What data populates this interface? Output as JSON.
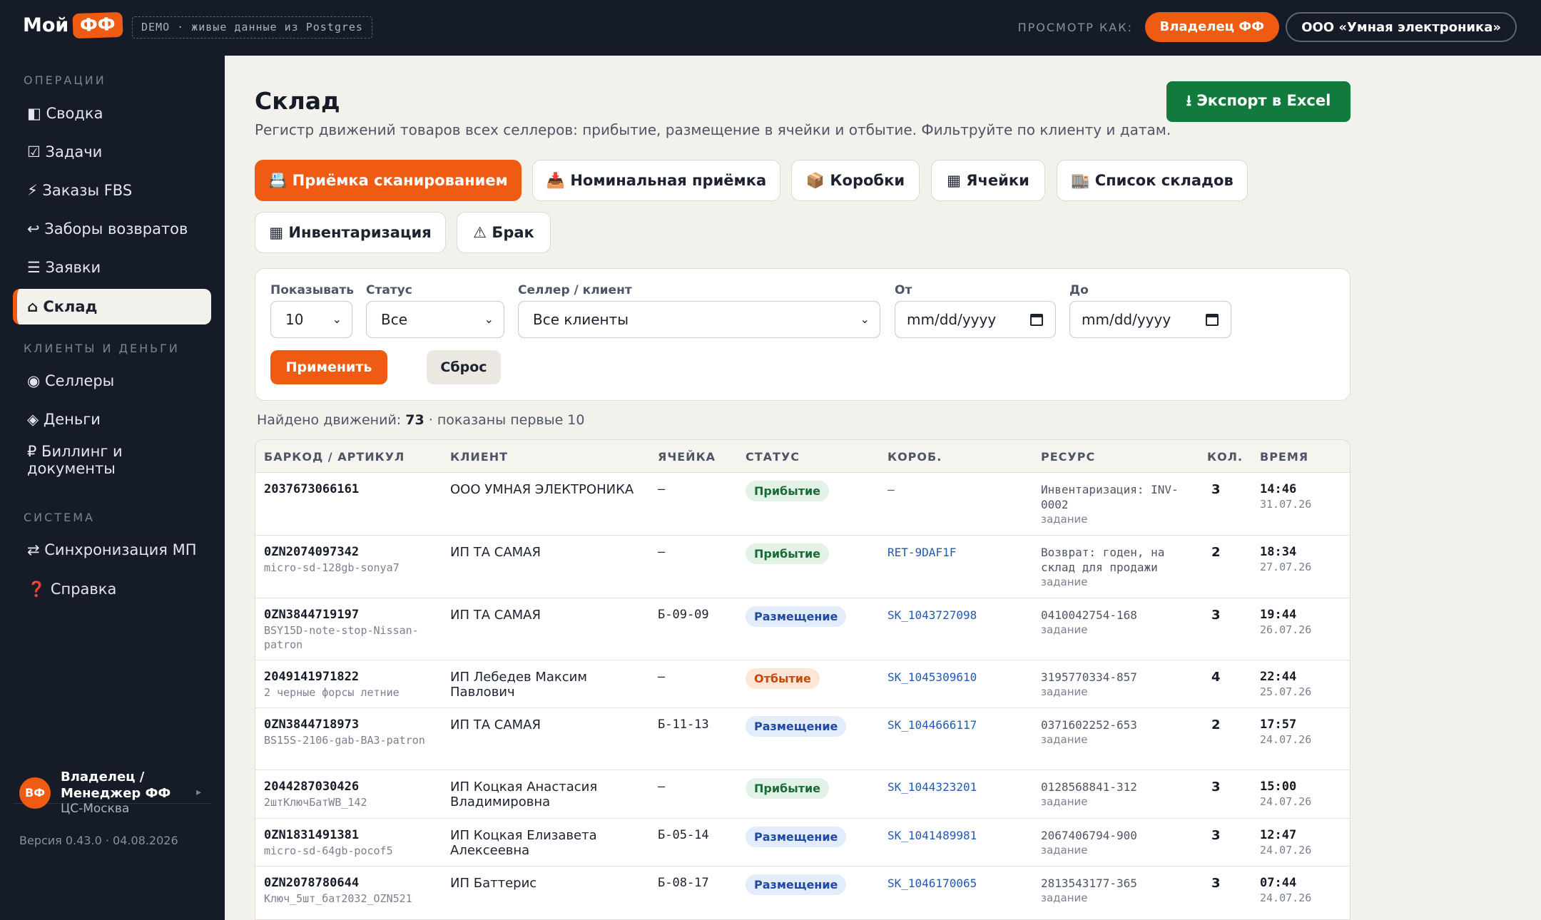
{
  "topbar": {
    "logo_text": "Мой",
    "logo_badge": "ФФ",
    "demo_label": "DEMO · живые данные из Postgres",
    "view_as_label": "ПРОСМОТР КАК:",
    "role_owner": "Владелец ФФ",
    "role_client": "ООО «Умная электроника»"
  },
  "sidebar": {
    "section_ops": "ОПЕРАЦИИ",
    "section_money": "КЛИЕНТЫ И ДЕНЬГИ",
    "section_system": "СИСТЕМА",
    "items": [
      {
        "label": "◧ Сводка"
      },
      {
        "label": "☑ Задачи"
      },
      {
        "label": "⚡ Заказы FBS"
      },
      {
        "label": "↩ Заборы возвратов"
      },
      {
        "label": "☰ Заявки"
      },
      {
        "label": "⌂ Склад"
      },
      {
        "label": "◉ Селлеры"
      },
      {
        "label": "◈ Деньги"
      },
      {
        "label": "₽ Биллинг и документы"
      },
      {
        "label": "⇄ Синхронизация МП"
      },
      {
        "label": "❓ Справка"
      }
    ],
    "user": {
      "initials": "ВФ",
      "name": "Владелец / Менеджер ФФ",
      "place": "ЦС-Москва"
    },
    "version": "Версия 0.43.0 · 04.08.2026"
  },
  "page": {
    "title": "Склад",
    "subtitle": "Регистр движений товаров всех селлеров: прибытие, размещение в ячейки и отбытие. Фильтруйте по клиенту и датам.",
    "export_label": "⭳ Экспорт в Excel"
  },
  "tabs": [
    {
      "label": "📇 Приёмка сканированием"
    },
    {
      "label": "📥 Номинальная приёмка"
    },
    {
      "label": "📦 Коробки"
    },
    {
      "label": "▦ Ячейки"
    },
    {
      "label": "🏬 Список складов"
    },
    {
      "label": "▦ Инвентаризация"
    },
    {
      "label": "⚠ Брак"
    }
  ],
  "filters": {
    "show_label": "Показывать",
    "show_value": "10",
    "status_label": "Статус",
    "status_value": "Все",
    "seller_label": "Селлер / клиент",
    "seller_value": "Все клиенты",
    "from_label": "От",
    "from_placeholder": "mm/dd/yyyy",
    "to_label": "До",
    "to_placeholder": "mm/dd/yyyy",
    "apply_label": "Применить",
    "reset_label": "Сброс"
  },
  "summary": {
    "prefix": "Найдено движений:",
    "count": "73",
    "suffix": "· показаны первые 10"
  },
  "table": {
    "columns": [
      "БАРКОД / АРТИКУЛ",
      "КЛИЕНТ",
      "ЯЧЕЙКА",
      "СТАТУС",
      "КОРОБ.",
      "РЕСУРС",
      "КОЛ.",
      "ВРЕМЯ"
    ],
    "rows": [
      {
        "barcode": "2037673066161",
        "article": "",
        "client": "ООО УМНАЯ ЭЛЕКТРОНИКА",
        "cell": "—",
        "status": "Прибытие",
        "status_kind": "arrival",
        "box": "—",
        "resource": "Инвентаризация: INV-0002",
        "resource_sub": "задание",
        "qty": "3",
        "time": "14:46",
        "date": "31.07.26"
      },
      {
        "barcode": "0ZN2074097342",
        "article": "micro-sd-128gb-sonya7",
        "client": "ИП ТА САМАЯ",
        "cell": "—",
        "status": "Прибытие",
        "status_kind": "arrival",
        "box": "RET-9DAF1F",
        "resource": "Возврат: годен, на склад для продажи",
        "resource_sub": "задание",
        "qty": "2",
        "time": "18:34",
        "date": "27.07.26"
      },
      {
        "barcode": "0ZN3844719197",
        "article": "BSY15D-note-stop-Nissan-patron",
        "client": "ИП ТА САМАЯ",
        "cell": "Б-09-09",
        "status": "Размещение",
        "status_kind": "place",
        "box": "SK_1043727098",
        "resource": "0410042754-168",
        "resource_sub": "задание",
        "qty": "3",
        "time": "19:44",
        "date": "26.07.26"
      },
      {
        "barcode": "2049141971822",
        "article": "2 черные форсы летние",
        "client": "ИП Лебедев Максим Павлович",
        "cell": "—",
        "status": "Отбытие",
        "status_kind": "out",
        "box": "SK_1045309610",
        "resource": "3195770334-857",
        "resource_sub": "задание",
        "qty": "4",
        "time": "22:44",
        "date": "25.07.26"
      },
      {
        "barcode": "0ZN3844718973",
        "article": "BS15S-2106-gab-BA3-patron",
        "client": "ИП ТА САМАЯ",
        "cell": "Б-11-13",
        "status": "Размещение",
        "status_kind": "place",
        "box": "SK_1044666117",
        "resource": "0371602252-653",
        "resource_sub": "задание",
        "qty": "2",
        "time": "17:57",
        "date": "24.07.26"
      },
      {
        "barcode": "2044287030426",
        "article": "2штКлючБатWB_142",
        "client": "ИП Коцкая Анастасия Владимировна",
        "cell": "—",
        "status": "Прибытие",
        "status_kind": "arrival",
        "box": "SK_1044323201",
        "resource": "0128568841-312",
        "resource_sub": "задание",
        "qty": "3",
        "time": "15:00",
        "date": "24.07.26"
      },
      {
        "barcode": "0ZN1831491381",
        "article": "micro-sd-64gb-pocof5",
        "client": "ИП Коцкая Елизавета Алексеевна",
        "cell": "Б-05-14",
        "status": "Размещение",
        "status_kind": "place",
        "box": "SK_1041489981",
        "resource": "2067406794-900",
        "resource_sub": "задание",
        "qty": "3",
        "time": "12:47",
        "date": "24.07.26"
      },
      {
        "barcode": "0ZN2078780644",
        "article": "Ключ_5шт_бат2032_OZN521",
        "client": "ИП Баттерис",
        "cell": "Б-08-17",
        "status": "Размещение",
        "status_kind": "place",
        "box": "SK_1046170065",
        "resource": "2813543177-365",
        "resource_sub": "задание",
        "qty": "3",
        "time": "07:44",
        "date": "24.07.26"
      }
    ]
  },
  "colors": {
    "accent": "#ef5b12",
    "sidebar_bg": "#161b28",
    "export_green": "#137a3d",
    "page_bg": "#f3f1ec"
  }
}
